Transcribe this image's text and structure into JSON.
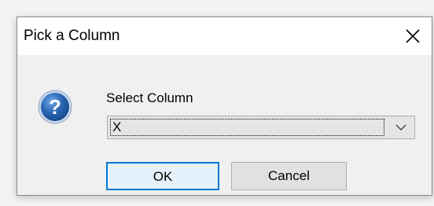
{
  "dialog": {
    "title": "Pick a Column",
    "close_icon": "close-icon",
    "help_icon": "question-icon",
    "field_label": "Select Column",
    "selected_column": "X",
    "dropdown_icon": "chevron-down-icon",
    "ok_label": "OK",
    "cancel_label": "Cancel"
  },
  "colors": {
    "accent": "#0078d7",
    "icon_blue": "#1f5fa8",
    "dialog_bg": "#f0f0f0",
    "titlebar_bg": "#ffffff"
  }
}
